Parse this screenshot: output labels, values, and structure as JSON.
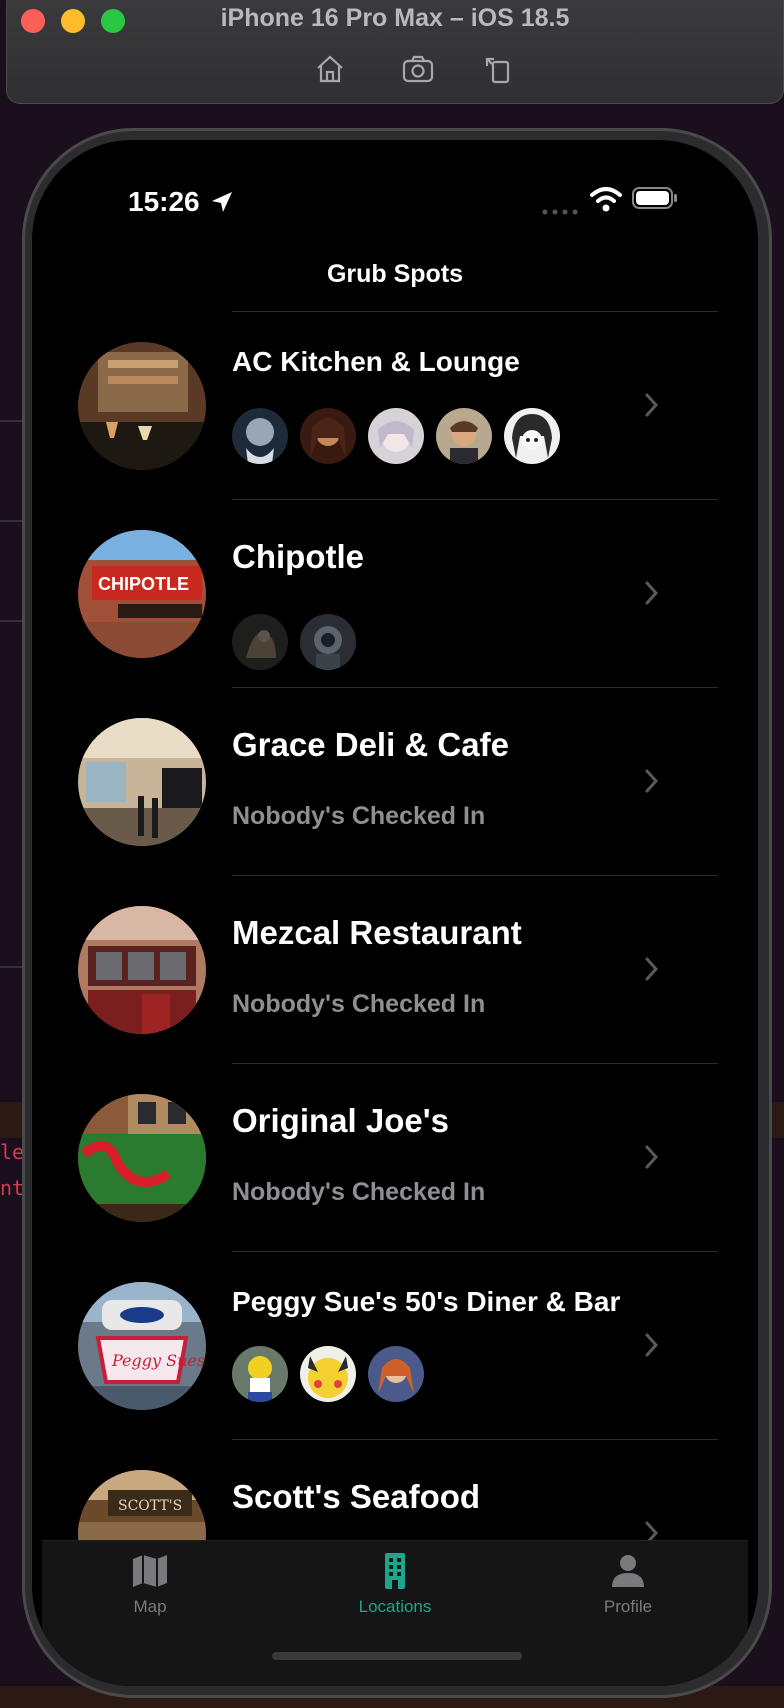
{
  "window": {
    "title": "iPhone 16 Pro Max – iOS 18.5",
    "toolbar_icons": [
      "home-icon",
      "screenshot-icon",
      "rotate-icon"
    ]
  },
  "background_code": {
    "line1": "le t",
    "line2": "nt ;"
  },
  "status_bar": {
    "time": "15:26"
  },
  "nav": {
    "title": "Grub Spots"
  },
  "locations": [
    {
      "name": "AC Kitchen & Lounge",
      "status": "",
      "avatar_count": 5
    },
    {
      "name": "Chipotle",
      "status": "",
      "avatar_count": 2
    },
    {
      "name": "Grace Deli & Cafe",
      "status": "Nobody's Checked In",
      "avatar_count": 0
    },
    {
      "name": "Mezcal Restaurant",
      "status": "Nobody's Checked In",
      "avatar_count": 0
    },
    {
      "name": "Original Joe's",
      "status": "Nobody's Checked In",
      "avatar_count": 0
    },
    {
      "name": "Peggy Sue's 50's Diner & Bar",
      "status": "",
      "avatar_count": 3
    },
    {
      "name": "Scott's Seafood",
      "status": "",
      "avatar_count": 0
    }
  ],
  "tabs": [
    {
      "label": "Map",
      "icon": "map-icon"
    },
    {
      "label": "Locations",
      "icon": "building-icon"
    },
    {
      "label": "Profile",
      "icon": "person-icon"
    }
  ],
  "colors": {
    "accent": "#1ea58a",
    "secondary_text": "#8e8e93"
  }
}
